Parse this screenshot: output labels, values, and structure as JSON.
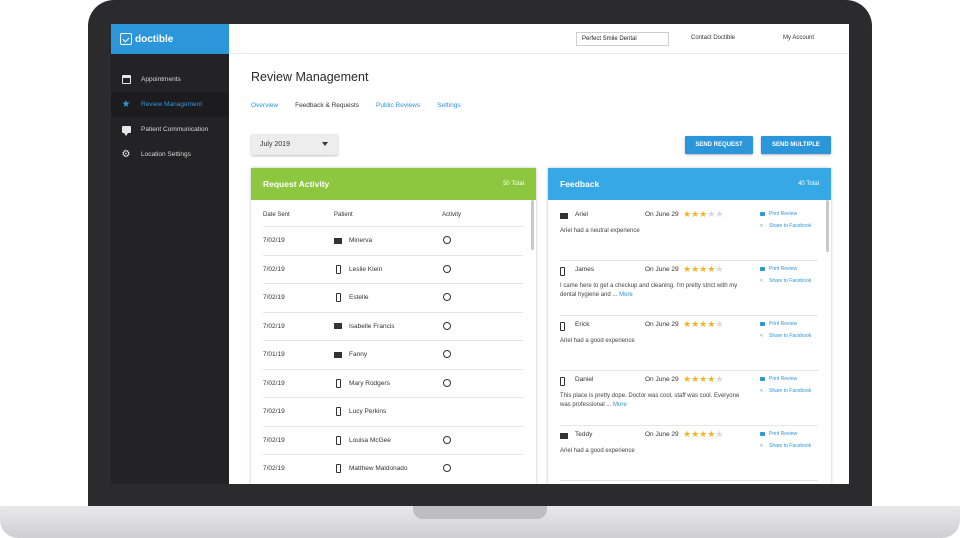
{
  "brand": {
    "name": "doctible"
  },
  "sidebar": {
    "items": [
      {
        "label": "Appointments",
        "icon": "calendar-icon"
      },
      {
        "label": "Review Management",
        "icon": "star-icon",
        "active": true
      },
      {
        "label": "Patient Communication",
        "icon": "chat-icon"
      },
      {
        "label": "Location Settings",
        "icon": "gear-icon"
      }
    ]
  },
  "topbar": {
    "practice": "Perfect Smile Dental",
    "contact": "Contact Doctible",
    "account": "My Account"
  },
  "page": {
    "title": "Review Management",
    "tabs": [
      "Overview",
      "Feedback & Requests",
      "Public Reviews",
      "Settings"
    ],
    "active_tab": "Feedback & Requests"
  },
  "filter": {
    "selected": "July 2019"
  },
  "actions": {
    "send_request": "SEND REQUEST",
    "send_multiple": "SEND MULTIPLE"
  },
  "request_activity": {
    "title": "Request Activity",
    "count": "50 Total",
    "columns": [
      "Date Sent",
      "Patient",
      "Activity"
    ],
    "rows": [
      {
        "date": "7/02/19",
        "channel": "email",
        "patient": "Minerva",
        "activity": true
      },
      {
        "date": "7/02/19",
        "channel": "phone",
        "patient": "Leslie Klein",
        "activity": true
      },
      {
        "date": "7/02/19",
        "channel": "phone",
        "patient": "Estelle",
        "activity": true
      },
      {
        "date": "7/02/19",
        "channel": "email",
        "patient": "Isabelle Francis",
        "activity": true
      },
      {
        "date": "7/01/19",
        "channel": "email",
        "patient": "Fanny",
        "activity": true
      },
      {
        "date": "7/02/19",
        "channel": "phone",
        "patient": "Mary Rodgers",
        "activity": true
      },
      {
        "date": "7/02/19",
        "channel": "phone",
        "patient": "Lucy Perkins",
        "activity": false
      },
      {
        "date": "7/02/19",
        "channel": "phone",
        "patient": "Louisa McGee",
        "activity": true
      },
      {
        "date": "7/02/19",
        "channel": "phone",
        "patient": "Matthew Maldonado",
        "activity": true
      }
    ]
  },
  "feedback": {
    "title": "Feedback",
    "count": "40 Total",
    "print_label": "Print Review",
    "share_label": "Share to Facebook",
    "more_label": "More",
    "items": [
      {
        "channel": "email",
        "name": "Ariel",
        "date": "On June 29",
        "rating": 3,
        "text": "Ariel had a neutral experience",
        "more": false
      },
      {
        "channel": "phone",
        "name": "James",
        "date": "On June 29",
        "rating": 4,
        "text": "I came here to get a checkup and cleaning. I'm pretty strict with my dental hygiene and ...",
        "more": true
      },
      {
        "channel": "phone",
        "name": "Erick",
        "date": "On June 29",
        "rating": 4,
        "text": "Ariel had a good experience",
        "more": false
      },
      {
        "channel": "phone",
        "name": "Daniel",
        "date": "On June 29",
        "rating": 4,
        "text": "This place is pretty dope. Doctor was cool, staff was cool. Everyone was professional ...",
        "more": true
      },
      {
        "channel": "email",
        "name": "Teddy",
        "date": "On June 29",
        "rating": 4,
        "text": "Ariel had a good experience",
        "more": false
      }
    ]
  },
  "colors": {
    "accent": "#2c96da",
    "green": "#8dc63f",
    "feedback_blue": "#36a8e6",
    "sidebar": "#232325",
    "star": "#f0b429"
  }
}
